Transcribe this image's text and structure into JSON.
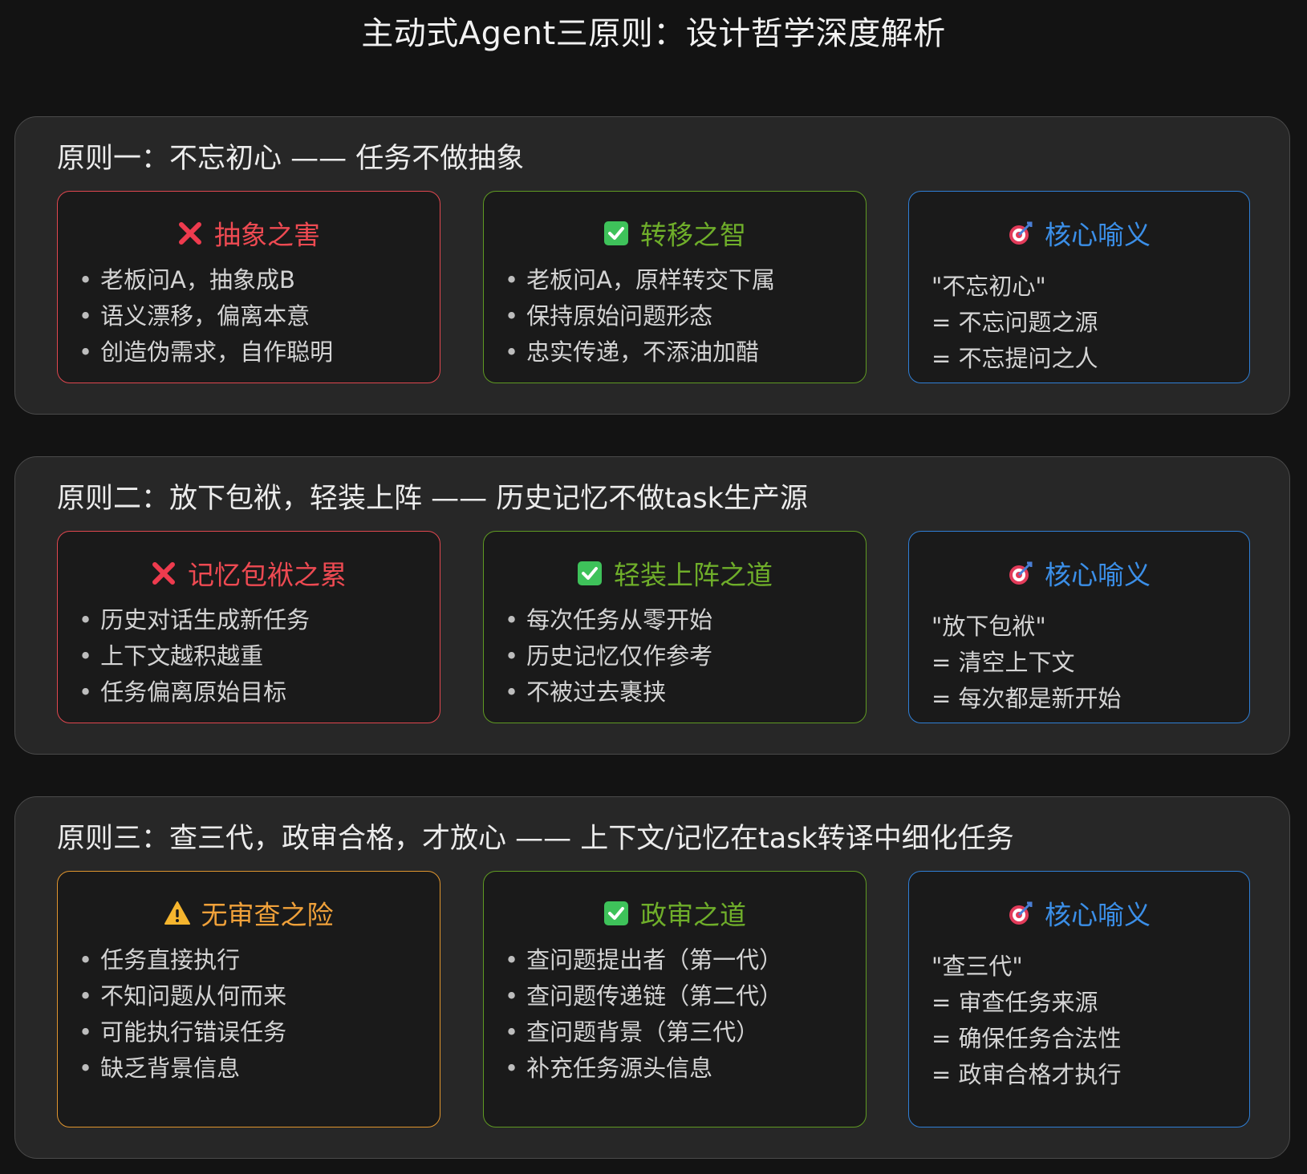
{
  "title": "主动式Agent三原则：设计哲学深度解析",
  "colors": {
    "background": "#131313",
    "panel": "#272727",
    "card": "#1a1a1a",
    "harm": "#e0474f",
    "good": "#5f9a22",
    "core": "#2f7fd6",
    "warn": "#e0952e"
  },
  "principles": [
    {
      "title": "原则一：不忘初心 —— 任务不做抽象",
      "harm": {
        "icon": "cross-mark-icon",
        "heading": "抽象之害",
        "items": [
          "老板问A，抽象成B",
          "语义漂移，偏离本意",
          "创造伪需求，自作聪明"
        ]
      },
      "good": {
        "icon": "check-box-icon",
        "heading": "转移之智",
        "items": [
          "老板问A，原样转交下属",
          "保持原始问题形态",
          "忠实传递，不添油加醋"
        ]
      },
      "core": {
        "icon": "target-dart-icon",
        "heading": "核心喻义",
        "lines": [
          "\"不忘初心\"",
          "= 不忘问题之源",
          "= 不忘提问之人"
        ]
      }
    },
    {
      "title": "原则二：放下包袱，轻装上阵 —— 历史记忆不做task生产源",
      "harm": {
        "icon": "cross-mark-icon",
        "heading": "记忆包袱之累",
        "items": [
          "历史对话生成新任务",
          "上下文越积越重",
          "任务偏离原始目标"
        ]
      },
      "good": {
        "icon": "check-box-icon",
        "heading": "轻装上阵之道",
        "items": [
          "每次任务从零开始",
          "历史记忆仅作参考",
          "不被过去裹挟"
        ]
      },
      "core": {
        "icon": "target-dart-icon",
        "heading": "核心喻义",
        "lines": [
          "\"放下包袱\"",
          "= 清空上下文",
          "= 每次都是新开始"
        ]
      }
    },
    {
      "title": "原则三：查三代，政审合格，才放心 —— 上下文/记忆在task转译中细化任务",
      "warn": {
        "icon": "warning-icon",
        "heading": "无审查之险",
        "items": [
          "任务直接执行",
          "不知问题从何而来",
          "可能执行错误任务",
          "缺乏背景信息"
        ]
      },
      "good": {
        "icon": "check-box-icon",
        "heading": "政审之道",
        "items": [
          "查问题提出者（第一代）",
          "查问题传递链（第二代）",
          "查问题背景（第三代）",
          "补充任务源头信息"
        ]
      },
      "core": {
        "icon": "target-dart-icon",
        "heading": "核心喻义",
        "lines": [
          "\"查三代\"",
          "= 审查任务来源",
          "= 确保任务合法性",
          "= 政审合格才执行"
        ]
      }
    }
  ]
}
